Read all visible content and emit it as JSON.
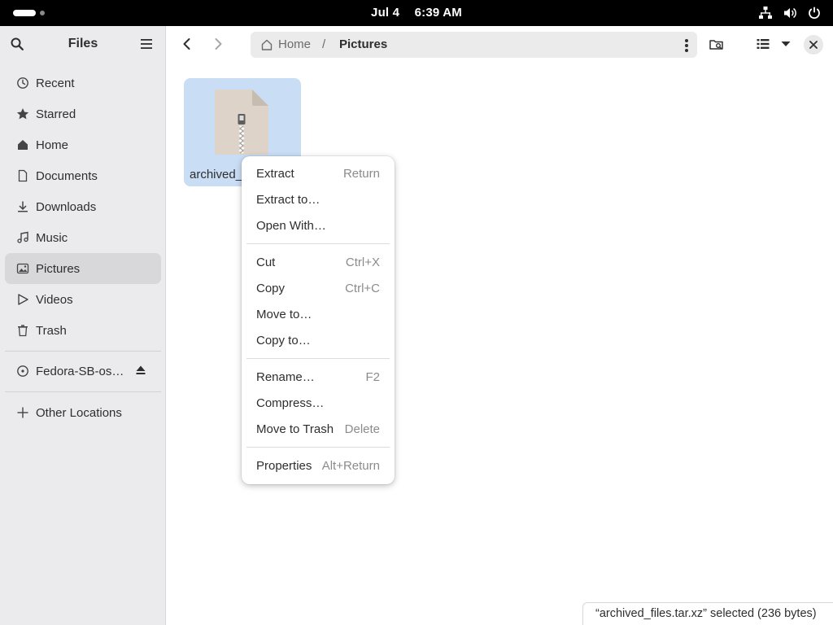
{
  "topbar": {
    "date": "Jul 4",
    "time": "6:39 AM",
    "tray_icons": [
      "network-icon",
      "volume-icon",
      "power-icon"
    ]
  },
  "sidebar": {
    "title": "Files",
    "items": [
      {
        "label": "Recent",
        "icon": "clock-icon",
        "active": false
      },
      {
        "label": "Starred",
        "icon": "star-icon",
        "active": false
      },
      {
        "label": "Home",
        "icon": "home-icon",
        "active": false
      },
      {
        "label": "Documents",
        "icon": "document-icon",
        "active": false
      },
      {
        "label": "Downloads",
        "icon": "download-icon",
        "active": false
      },
      {
        "label": "Music",
        "icon": "music-icon",
        "active": false
      },
      {
        "label": "Pictures",
        "icon": "picture-icon",
        "active": true
      },
      {
        "label": "Videos",
        "icon": "video-icon",
        "active": false
      },
      {
        "label": "Trash",
        "icon": "trash-icon",
        "active": false
      }
    ],
    "device": {
      "label": "Fedora-SB-os…",
      "icon": "disc-icon"
    },
    "other_locations": "Other Locations"
  },
  "pathbar": {
    "home": "Home",
    "separator": "/",
    "current": "Pictures"
  },
  "files": [
    {
      "name": "archived_files.tar.xz",
      "visible_name": "archived_f",
      "selected": true
    }
  ],
  "context_menu": {
    "groups": [
      [
        {
          "label": "Extract",
          "accel": "Return"
        },
        {
          "label": "Extract to…",
          "accel": ""
        },
        {
          "label": "Open With…",
          "accel": ""
        }
      ],
      [
        {
          "label": "Cut",
          "accel": "Ctrl+X"
        },
        {
          "label": "Copy",
          "accel": "Ctrl+C"
        },
        {
          "label": "Move to…",
          "accel": ""
        },
        {
          "label": "Copy to…",
          "accel": ""
        }
      ],
      [
        {
          "label": "Rename…",
          "accel": "F2"
        },
        {
          "label": "Compress…",
          "accel": ""
        },
        {
          "label": "Move to Trash",
          "accel": "Delete"
        }
      ],
      [
        {
          "label": "Properties",
          "accel": "Alt+Return"
        }
      ]
    ]
  },
  "status": {
    "text": "“archived_files.tar.xz” selected  (236 bytes)"
  },
  "colors": {
    "selection": "#c9ddf5",
    "sidebar_bg": "#ebebed",
    "sidebar_active": "#d8d8da",
    "topbar": "#000000"
  }
}
